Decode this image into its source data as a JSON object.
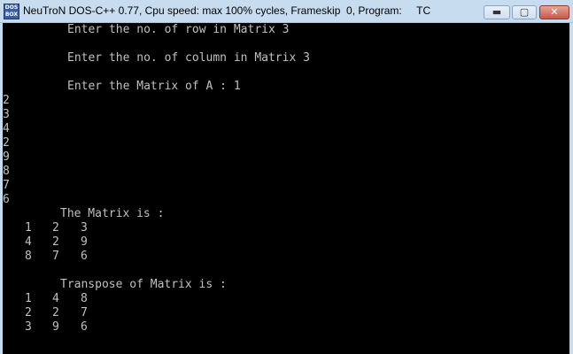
{
  "window": {
    "icon_text": "DOS BOX",
    "title": "NeuTroN DOS-C++ 0.77, Cpu speed: max 100% cycles, Frameskip  0, Program:     TC",
    "min_glyph": "▬",
    "max_glyph": "▢",
    "close_glyph": "✕"
  },
  "console": {
    "prompt_rows": "Enter the no. of row in Matrix 3",
    "prompt_cols": "Enter the no. of column in Matrix 3",
    "prompt_matrix": "Enter the Matrix of A : 1",
    "inputs": [
      "2",
      "3",
      "4",
      "2",
      "9",
      "8",
      "7",
      "6"
    ],
    "matrix_title": "The Matrix is :",
    "matrix": [
      [
        "1",
        "2",
        "3"
      ],
      [
        "4",
        "2",
        "9"
      ],
      [
        "8",
        "7",
        "6"
      ]
    ],
    "transpose_title": "Transpose of Matrix is :",
    "transpose": [
      [
        "1",
        "4",
        "8"
      ],
      [
        "2",
        "2",
        "7"
      ],
      [
        "3",
        "9",
        "6"
      ]
    ]
  }
}
